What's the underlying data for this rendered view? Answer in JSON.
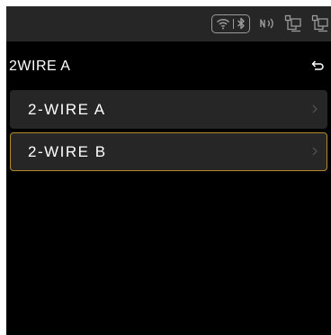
{
  "screen": {
    "title": "2WIRE A",
    "accent_color": "#b58a2b",
    "background_color": "#000000",
    "item_background_color": "#262626"
  },
  "status_bar": {
    "icons": [
      "wifi-icon",
      "bluetooth-icon",
      "nfc-icon",
      "network-icon",
      "network-icon"
    ]
  },
  "menu": {
    "items": [
      {
        "label": "2-WIRE  A",
        "selected": false
      },
      {
        "label": "2-WIRE  B",
        "selected": true
      }
    ]
  }
}
